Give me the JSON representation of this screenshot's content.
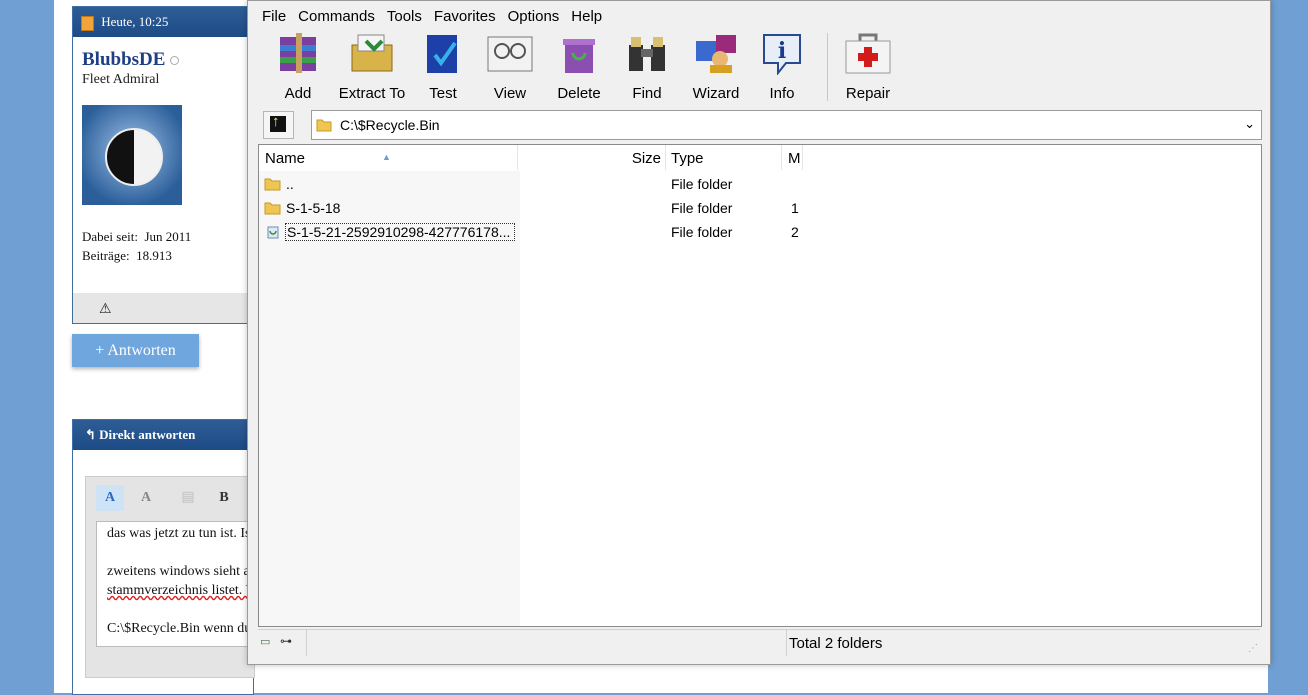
{
  "forum": {
    "post_time": "Heute, 10:25",
    "username": "BlubbsDE",
    "rank": "Fleet Admiral",
    "joined_label": "Dabei seit:",
    "joined_value": "Jun 2011",
    "posts_label": "Beiträge:",
    "posts_value": "18.913",
    "reply_button": "+ Antworten",
    "direct_reply_title": "Direkt antworten",
    "editor_lines": [
      "das was jetzt zu tun ist. Is",
      "zweitens windows sieht a",
      "stammverzeichnis listet. V",
      "C:\\$Recycle.Bin wenn du"
    ]
  },
  "winrar": {
    "menu": [
      "File",
      "Commands",
      "Tools",
      "Favorites",
      "Options",
      "Help"
    ],
    "toolbar": [
      "Add",
      "Extract To",
      "Test",
      "View",
      "Delete",
      "Find",
      "Wizard",
      "Info",
      "Repair"
    ],
    "path": "C:\\$Recycle.Bin",
    "columns": [
      "Name",
      "Size",
      "Type",
      "M"
    ],
    "rows": [
      {
        "name": "..",
        "type": "File folder",
        "m": ""
      },
      {
        "name": "S-1-5-18",
        "type": "File folder",
        "m": "1"
      },
      {
        "name": "S-1-5-21-2592910298-427776178...",
        "type": "File folder",
        "m": "2"
      }
    ],
    "status": "Total 2 folders"
  }
}
